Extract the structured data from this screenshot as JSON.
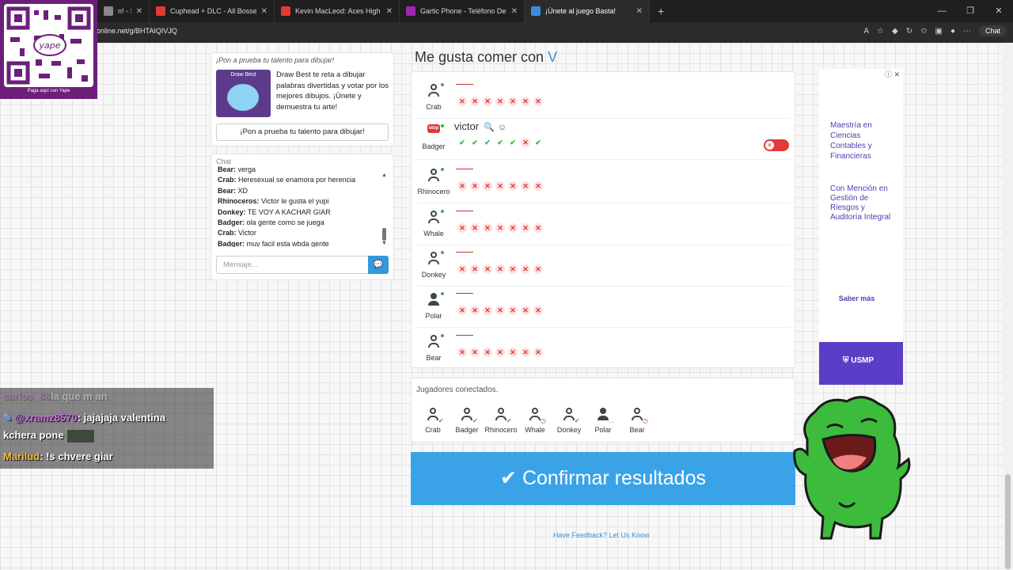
{
  "browser": {
    "tabs": [
      {
        "label": "n! - Studiop",
        "icon_color": "#888888"
      },
      {
        "label": "Cuphead + DLC - All Bosses S",
        "icon_color": "#e53935"
      },
      {
        "label": "Kevin MacLeod: Aces High but lov",
        "icon_color": "#e53935"
      },
      {
        "label": "Gartic Phone - Teléfono Descomp",
        "icon_color": "#9c27b0"
      },
      {
        "label": "¡Únete al juego Basta!",
        "icon_color": "#3a8fd8"
      }
    ],
    "url": "online.net/g/BHTAIQIVJQ",
    "chat_button": "Chat"
  },
  "qr": {
    "label": "Paga aquí con Yape"
  },
  "promo": {
    "title": "¡Pon a prueba tu talento para dibujar!",
    "image_caption": "Draw Best",
    "text": "Draw Best te reta a dibujar palabras divertidas y votar por los mejores dibujos. ¡Únete y demuestra tu arte!",
    "button": "¡Pon a prueba tu talento para dibujar!"
  },
  "chat": {
    "title": "Chat",
    "messages": [
      {
        "user": "Bear:",
        "text": "verga"
      },
      {
        "user": "Crab:",
        "text": "Heresexual se enamora por herencia"
      },
      {
        "user": "Bear:",
        "text": "XD"
      },
      {
        "user": "Rhinoceros:",
        "text": "Victor le gusta el yupi"
      },
      {
        "user": "Donkey:",
        "text": "TE VOY A KACHAR GIAR"
      },
      {
        "user": "Badger:",
        "text": "ola gente como se juega"
      },
      {
        "user": "Crab:",
        "text": "Victor"
      },
      {
        "user": "Badger:",
        "text": "muy facil esta wbda gente"
      }
    ],
    "input_placeholder": "Mensaje..."
  },
  "question": {
    "prefix": "Me gusta comer con",
    "letter": "V"
  },
  "players": [
    {
      "name": "Crab",
      "answer": "",
      "marks": [
        "x",
        "x",
        "x",
        "x",
        "x",
        "x",
        "x"
      ]
    },
    {
      "name": "Badger",
      "answer": "victor",
      "stop": "stop",
      "marks": [
        "ok",
        "ok",
        "ok",
        "ok",
        "ok",
        "x",
        "ok"
      ]
    },
    {
      "name": "Rhinocero",
      "answer": "",
      "marks": [
        "x",
        "x",
        "x",
        "x",
        "x",
        "x",
        "x"
      ]
    },
    {
      "name": "Whale",
      "answer": "",
      "marks": [
        "x",
        "x",
        "x",
        "x",
        "x",
        "x",
        "x"
      ]
    },
    {
      "name": "Donkey",
      "answer": "",
      "marks": [
        "x",
        "x",
        "x",
        "x",
        "x",
        "x",
        "x"
      ]
    },
    {
      "name": "Polar",
      "answer": "",
      "marks": [
        "x",
        "x",
        "x",
        "x",
        "x",
        "x",
        "x"
      ]
    },
    {
      "name": "Bear",
      "answer": "",
      "marks": [
        "x",
        "x",
        "x",
        "x",
        "x",
        "x",
        "x"
      ]
    }
  ],
  "connected": {
    "title": "Jugadores conectados.",
    "players": [
      {
        "name": "Crab",
        "status": "ok"
      },
      {
        "name": "Badger",
        "status": "ok"
      },
      {
        "name": "Rhinocero",
        "status": "ok"
      },
      {
        "name": "Whale",
        "status": "wait"
      },
      {
        "name": "Donkey",
        "status": "ok"
      },
      {
        "name": "Polar",
        "status": "typing"
      },
      {
        "name": "Bear",
        "status": "wait"
      }
    ]
  },
  "confirm_button": "Confirmar resultados",
  "feedback": "Have Feedback? Let Us Know",
  "ad": {
    "line1": "Maestría en Ciencias Contables y Financieras",
    "line2": "Con Mención en Gestión de Riesgos y Auditoría Integral",
    "cta": "Saber más",
    "brand": "USMP"
  },
  "stream_chat": {
    "lines": [
      {
        "user": "carlos_88",
        "text": "la que m an",
        "faded": true
      },
      {
        "user": "@xramz8570",
        "text": ": jajajaja valentina"
      },
      {
        "user": "",
        "text": "kchera pone"
      },
      {
        "user": "Marilud",
        "text": ": !s chvere giar"
      }
    ]
  },
  "colors": {
    "accent": "#3aa3e8",
    "wrong": "#d93a3a",
    "correct": "#3cb043",
    "frog": "#3dbb3d"
  }
}
